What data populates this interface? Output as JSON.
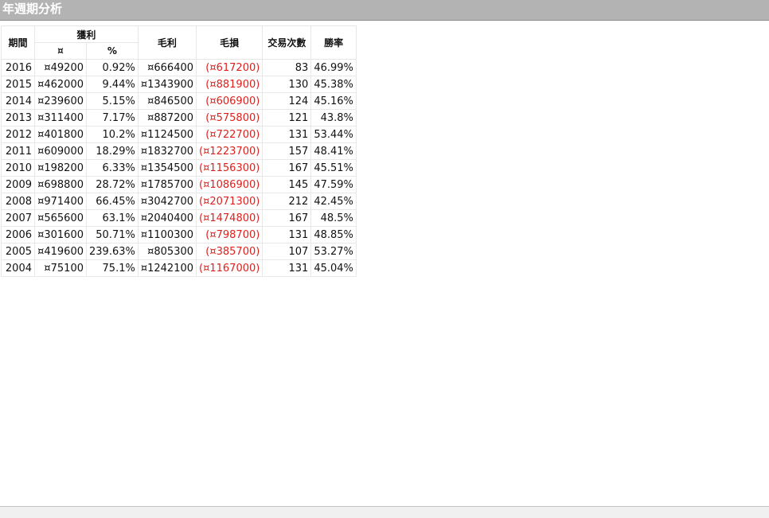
{
  "title": "年週期分析",
  "table": {
    "headers": {
      "period": "期間",
      "profit": "獲利",
      "profit_amount": "¤",
      "profit_pct": "%",
      "gross_profit": "毛利",
      "gross_loss": "毛損",
      "trades": "交易次數",
      "win_rate": "勝率"
    },
    "rows": [
      {
        "period": "2016",
        "profit": "¤49200",
        "pct": "0.92%",
        "gross_profit": "¤666400",
        "gross_loss": "(¤617200)",
        "trades": "83",
        "win_rate": "46.99%"
      },
      {
        "period": "2015",
        "profit": "¤462000",
        "pct": "9.44%",
        "gross_profit": "¤1343900",
        "gross_loss": "(¤881900)",
        "trades": "130",
        "win_rate": "45.38%"
      },
      {
        "period": "2014",
        "profit": "¤239600",
        "pct": "5.15%",
        "gross_profit": "¤846500",
        "gross_loss": "(¤606900)",
        "trades": "124",
        "win_rate": "45.16%"
      },
      {
        "period": "2013",
        "profit": "¤311400",
        "pct": "7.17%",
        "gross_profit": "¤887200",
        "gross_loss": "(¤575800)",
        "trades": "121",
        "win_rate": "43.8%"
      },
      {
        "period": "2012",
        "profit": "¤401800",
        "pct": "10.2%",
        "gross_profit": "¤1124500",
        "gross_loss": "(¤722700)",
        "trades": "131",
        "win_rate": "53.44%"
      },
      {
        "period": "2011",
        "profit": "¤609000",
        "pct": "18.29%",
        "gross_profit": "¤1832700",
        "gross_loss": "(¤1223700)",
        "trades": "157",
        "win_rate": "48.41%"
      },
      {
        "period": "2010",
        "profit": "¤198200",
        "pct": "6.33%",
        "gross_profit": "¤1354500",
        "gross_loss": "(¤1156300)",
        "trades": "167",
        "win_rate": "45.51%"
      },
      {
        "period": "2009",
        "profit": "¤698800",
        "pct": "28.72%",
        "gross_profit": "¤1785700",
        "gross_loss": "(¤1086900)",
        "trades": "145",
        "win_rate": "47.59%"
      },
      {
        "period": "2008",
        "profit": "¤971400",
        "pct": "66.45%",
        "gross_profit": "¤3042700",
        "gross_loss": "(¤2071300)",
        "trades": "212",
        "win_rate": "42.45%"
      },
      {
        "period": "2007",
        "profit": "¤565600",
        "pct": "63.1%",
        "gross_profit": "¤2040400",
        "gross_loss": "(¤1474800)",
        "trades": "167",
        "win_rate": "48.5%"
      },
      {
        "period": "2006",
        "profit": "¤301600",
        "pct": "50.71%",
        "gross_profit": "¤1100300",
        "gross_loss": "(¤798700)",
        "trades": "131",
        "win_rate": "48.85%"
      },
      {
        "period": "2005",
        "profit": "¤419600",
        "pct": "239.63%",
        "gross_profit": "¤805300",
        "gross_loss": "(¤385700)",
        "trades": "107",
        "win_rate": "53.27%"
      },
      {
        "period": "2004",
        "profit": "¤75100",
        "pct": "75.1%",
        "gross_profit": "¤1242100",
        "gross_loss": "(¤1167000)",
        "trades": "131",
        "win_rate": "45.04%"
      }
    ]
  },
  "colors": {
    "title_bar": "#b3b3b3",
    "loss_text": "#e0201c"
  }
}
